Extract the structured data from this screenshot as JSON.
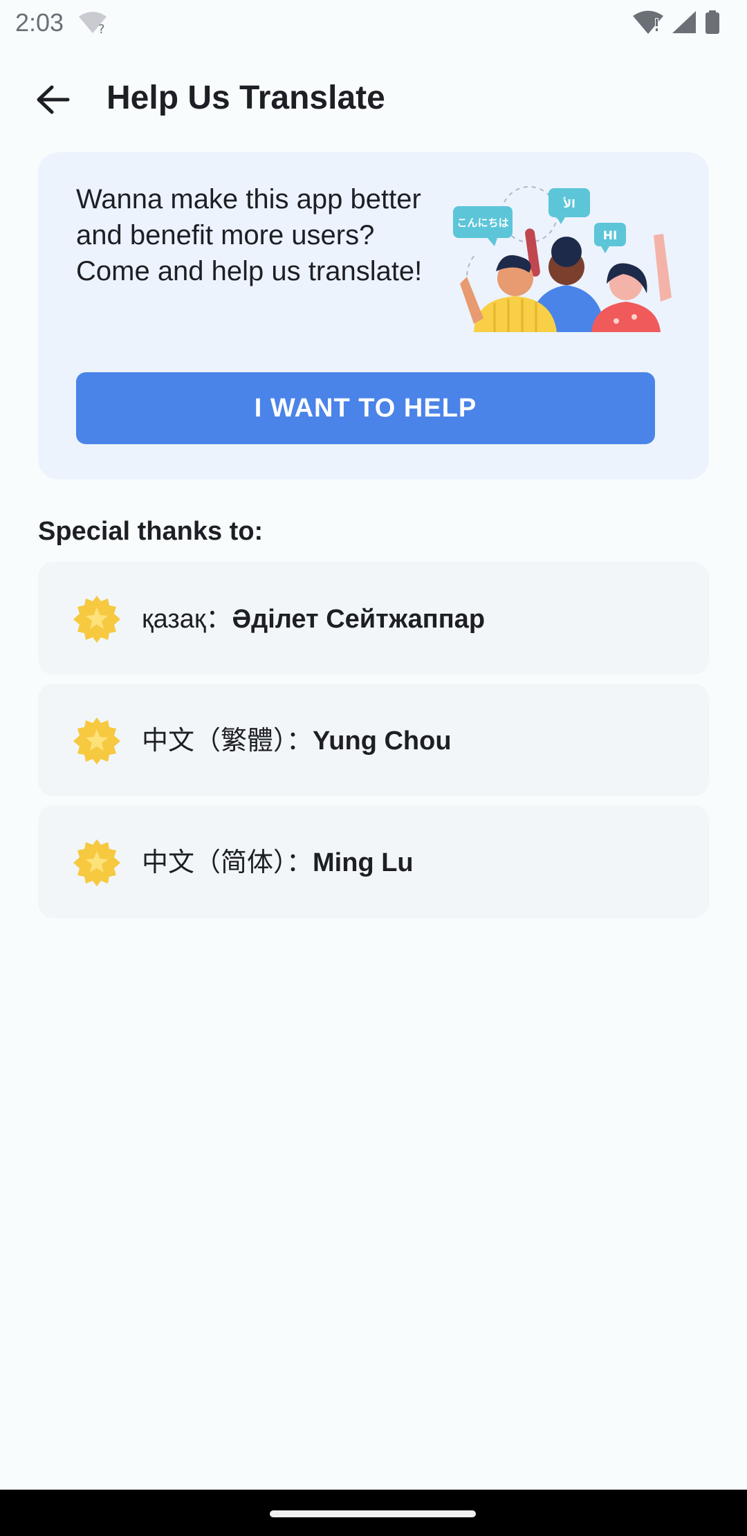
{
  "status_bar": {
    "time": "2:03"
  },
  "header": {
    "title": "Help Us Translate"
  },
  "banner": {
    "text": "Wanna make this app better and benefit more users? Come and help us translate!",
    "button_label": "I WANT TO HELP",
    "bubbles": [
      "こんにちは",
      "الأ",
      "HI"
    ]
  },
  "section": {
    "title": "Special thanks to:"
  },
  "thanks": [
    {
      "language": "қазақ：",
      "name": "Әділет Сейтжаппар"
    },
    {
      "language": "中文（繁體）：",
      "name": "Yung Chou"
    },
    {
      "language": "中文（简体）：",
      "name": "Ming Lu"
    }
  ],
  "colors": {
    "accent": "#4a84e8",
    "banner_bg": "#ecf3fd",
    "badge": "#f6c940"
  }
}
